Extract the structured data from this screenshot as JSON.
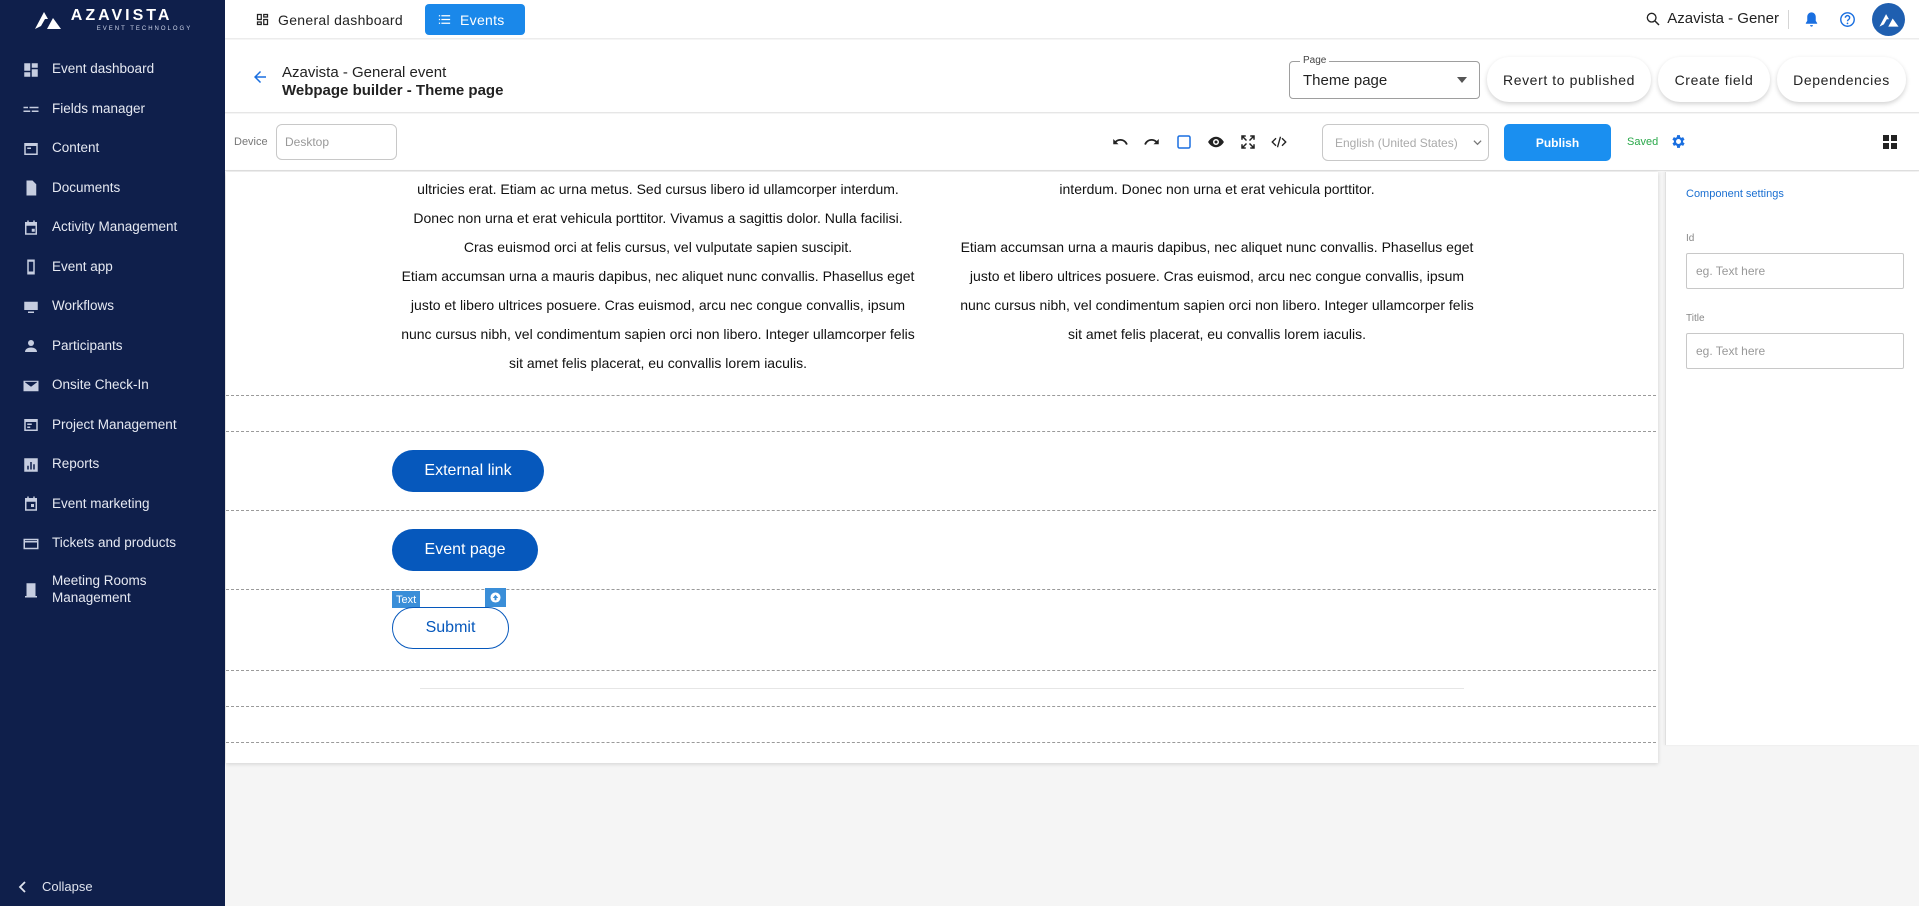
{
  "brand": {
    "name": "AZAVISTA",
    "tagline": "EVENT TECHNOLOGY"
  },
  "sidebar": {
    "items": [
      {
        "label": "Event dashboard",
        "icon": "dashboard-icon"
      },
      {
        "label": "Fields manager",
        "icon": "fields-icon"
      },
      {
        "label": "Content",
        "icon": "content-icon"
      },
      {
        "label": "Documents",
        "icon": "document-icon"
      },
      {
        "label": "Activity Management",
        "icon": "calendar-icon"
      },
      {
        "label": "Event app",
        "icon": "phone-icon"
      },
      {
        "label": "Workflows",
        "icon": "workflow-icon"
      },
      {
        "label": "Participants",
        "icon": "person-icon"
      },
      {
        "label": "Onsite Check-In",
        "icon": "mail-icon"
      },
      {
        "label": "Project Management",
        "icon": "project-icon"
      },
      {
        "label": "Reports",
        "icon": "chart-icon"
      },
      {
        "label": "Event marketing",
        "icon": "calendar-event-icon"
      },
      {
        "label": "Tickets and products",
        "icon": "card-icon"
      },
      {
        "label": "Meeting Rooms Management",
        "icon": "room-icon"
      }
    ],
    "collapse_label": "Collapse"
  },
  "topbar": {
    "tab_dashboard": "General dashboard",
    "tab_events": "Events",
    "search_text": "Azavista - Gener"
  },
  "event_header": {
    "event_name": "Azavista - General event",
    "builder_title": "Webpage builder - Theme page",
    "page_select_legend": "Page",
    "page_select_value": "Theme page",
    "revert_label": "Revert to published",
    "create_label": "Create field",
    "dependencies_label": "Dependencies"
  },
  "toolbar": {
    "device_label": "Device",
    "device_placeholder": "Desktop",
    "language": "English (United States)",
    "publish_label": "Publish",
    "saved_label": "Saved"
  },
  "canvas": {
    "left_column": [
      "ultricies erat. Etiam ac urna metus. Sed cursus libero id ullamcorper interdum.",
      "Donec non urna et erat vehicula porttitor. Vivamus a sagittis dolor. Nulla facilisi.",
      "Cras euismod orci at felis cursus, vel vulputate sapien suscipit.",
      "Etiam accumsan urna a mauris dapibus, nec aliquet nunc convallis. Phasellus eget",
      "justo et libero ultrices posuere. Cras euismod, arcu nec congue convallis, ipsum",
      "nunc cursus nibh, vel condimentum sapien orci non libero. Integer ullamcorper felis",
      "sit amet felis placerat, eu convallis lorem iaculis."
    ],
    "right_column": [
      "interdum. Donec non urna et erat vehicula porttitor.",
      "",
      "Etiam accumsan urna a mauris dapibus, nec aliquet nunc convallis. Phasellus eget",
      "justo et libero ultrices posuere. Cras euismod, arcu nec congue convallis, ipsum",
      "nunc cursus nibh, vel condimentum sapien orci non libero. Integer ullamcorper felis",
      "sit amet felis placerat, eu convallis lorem iaculis."
    ],
    "button_external": "External link",
    "button_event": "Event page",
    "button_submit": "Submit",
    "selected_badge": "Text"
  },
  "settings": {
    "title": "Component settings",
    "id_label": "Id",
    "id_placeholder": "eg. Text here",
    "title_label": "Title",
    "title_placeholder": "eg. Text here"
  },
  "colors": {
    "sidebar_bg": "#0f1f4b",
    "accent": "#1a88ea",
    "button_blue": "#0658bc",
    "saved_green": "#2aa84a"
  }
}
